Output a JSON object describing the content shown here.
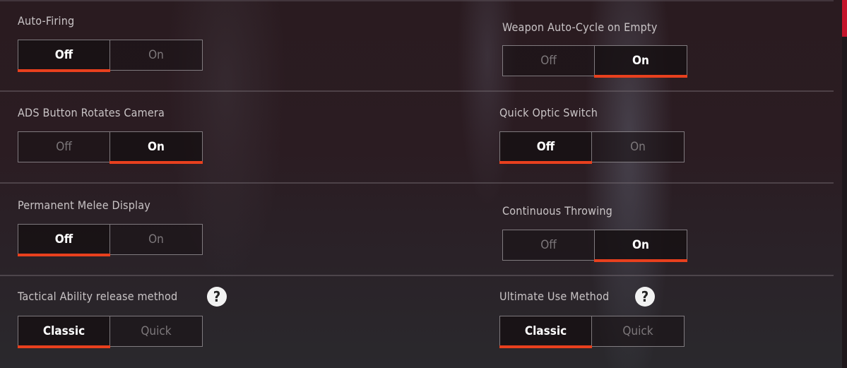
{
  "accent_color": "#e8401e",
  "settings": [
    {
      "label": "Auto-Firing",
      "options": [
        "Off",
        "On"
      ],
      "selected": "Off",
      "help": false
    },
    {
      "label": "Weapon Auto-Cycle on Empty",
      "options": [
        "Off",
        "On"
      ],
      "selected": "On",
      "help": false
    },
    {
      "label": "ADS Button Rotates Camera",
      "options": [
        "Off",
        "On"
      ],
      "selected": "On",
      "help": false
    },
    {
      "label": "Quick Optic Switch",
      "options": [
        "Off",
        "On"
      ],
      "selected": "Off",
      "help": false
    },
    {
      "label": "Permanent Melee Display",
      "options": [
        "Off",
        "On"
      ],
      "selected": "Off",
      "help": false
    },
    {
      "label": "Continuous Throwing",
      "options": [
        "Off",
        "On"
      ],
      "selected": "On",
      "help": false
    },
    {
      "label": "Tactical Ability release method",
      "options": [
        "Classic",
        "Quick"
      ],
      "selected": "Classic",
      "help": true,
      "help_icon": "?"
    },
    {
      "label": "Ultimate Use Method",
      "options": [
        "Classic",
        "Quick"
      ],
      "selected": "Classic",
      "help": true,
      "help_icon": "?"
    }
  ]
}
